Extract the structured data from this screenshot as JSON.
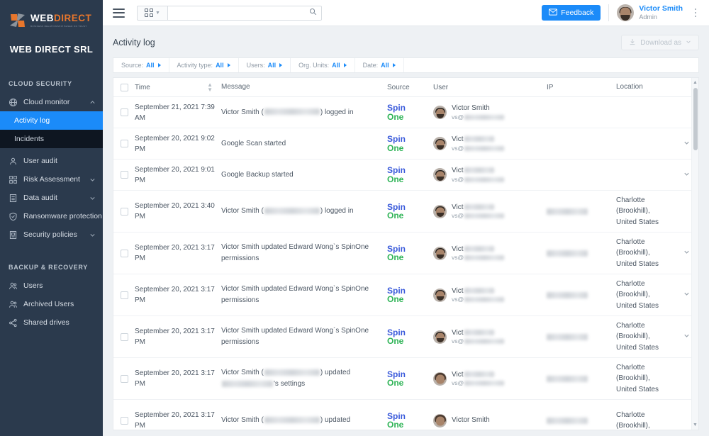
{
  "sidebar": {
    "logo": {
      "part1": "WEB",
      "part2": "DIRECT",
      "tagline": "BUSINESS RELATIONSHIP BASED ON TRUST"
    },
    "org_name": "WEB DIRECT SRL",
    "sections": [
      {
        "title": "CLOUD SECURITY",
        "items": [
          {
            "label": "Cloud monitor",
            "icon": "globe-icon",
            "caret": "up",
            "state": "expanded"
          },
          {
            "label": "Activity log",
            "icon": "",
            "state": "active-sub"
          },
          {
            "label": "Incidents",
            "icon": "",
            "state": "dark-sub"
          },
          {
            "label": "User audit",
            "icon": "person-icon",
            "caret": ""
          },
          {
            "label": "Risk Assessment",
            "icon": "grid-icon",
            "caret": "down"
          },
          {
            "label": "Data audit",
            "icon": "document-icon",
            "caret": "down"
          },
          {
            "label": "Ransomware protection",
            "icon": "shield-check-icon",
            "caret": ""
          },
          {
            "label": "Security policies",
            "icon": "policy-icon",
            "caret": "down"
          }
        ]
      },
      {
        "title": "BACKUP & RECOVERY",
        "items": [
          {
            "label": "Users",
            "icon": "users-icon",
            "caret": ""
          },
          {
            "label": "Archived Users",
            "icon": "users-archive-icon",
            "caret": ""
          },
          {
            "label": "Shared drives",
            "icon": "share-icon",
            "caret": ""
          }
        ]
      }
    ]
  },
  "topbar": {
    "menu_icon": "hamburger-icon",
    "app_switcher_icon": "grid-apps-icon",
    "search_placeholder": "",
    "search_value": "",
    "search_icon": "search-icon",
    "feedback_label": "Feedback",
    "feedback_icon": "envelope-icon",
    "user": {
      "name": "Victor Smith",
      "role": "Admin",
      "avatar": "user-avatar"
    },
    "overflow_icon": "kebab-menu-icon"
  },
  "page": {
    "title": "Activity log",
    "download_label": "Download as",
    "download_icon": "download-icon",
    "download_caret": "chevron-down-icon"
  },
  "filters": [
    {
      "label": "Source:",
      "value": "All"
    },
    {
      "label": "Activity type:",
      "value": "All"
    },
    {
      "label": "Users:",
      "value": "All"
    },
    {
      "label": "Org. Units:",
      "value": "All"
    },
    {
      "label": "Date:",
      "value": "All"
    }
  ],
  "table": {
    "columns": [
      "Time",
      "Message",
      "Source",
      "User",
      "IP",
      "Location"
    ],
    "source_logo": {
      "line1": "Spin",
      "line2": "One",
      "color1": "#3b5bdb",
      "color2": "#2fb457"
    },
    "rows": [
      {
        "time": "September 21, 2021 7:39 AM",
        "message_pre": "Victor Smith (",
        "message_post": ") logged in",
        "redacted_inline": true,
        "user_name": "Victor Smith",
        "user_mail_prefix": "vs@",
        "user_name_redacted": false,
        "ip_redacted": false,
        "location": "",
        "expandable": false,
        "avatar_variant": "male"
      },
      {
        "time": "September 20, 2021 9:02 PM",
        "message_pre": "Google Scan started",
        "message_post": "",
        "redacted_inline": false,
        "user_name": "Vict",
        "user_mail_prefix": "vs@",
        "user_name_redacted": true,
        "ip_redacted": false,
        "location": "",
        "expandable": true,
        "avatar_variant": "male"
      },
      {
        "time": "September 20, 2021 9:01 PM",
        "message_pre": "Google Backup started",
        "message_post": "",
        "redacted_inline": false,
        "user_name": "Vict",
        "user_mail_prefix": "vs@",
        "user_name_redacted": true,
        "ip_redacted": false,
        "location": "",
        "expandable": true,
        "avatar_variant": "male"
      },
      {
        "time": "September 20, 2021 3:40 PM",
        "message_pre": "Victor Smith (",
        "message_post": ") logged in",
        "redacted_inline": true,
        "user_name": "Vict",
        "user_mail_prefix": "vs@",
        "user_name_redacted": true,
        "ip_redacted": true,
        "location": "Charlotte (Brookhill), United States",
        "expandable": false,
        "avatar_variant": "male"
      },
      {
        "time": "September 20, 2021 3:17 PM",
        "message_pre": "Victor Smith updated Edward Wong`s SpinOne permissions",
        "message_post": "",
        "redacted_inline": false,
        "user_name": "Vict",
        "user_mail_prefix": "vs@",
        "user_name_redacted": true,
        "ip_redacted": true,
        "location": "Charlotte (Brookhill), United States",
        "expandable": true,
        "avatar_variant": "male"
      },
      {
        "time": "September 20, 2021 3:17 PM",
        "message_pre": "Victor Smith updated Edward Wong`s SpinOne permissions",
        "message_post": "",
        "redacted_inline": false,
        "user_name": "Vict",
        "user_mail_prefix": "vs@",
        "user_name_redacted": true,
        "ip_redacted": true,
        "location": "Charlotte (Brookhill), United States",
        "expandable": true,
        "avatar_variant": "male"
      },
      {
        "time": "September 20, 2021 3:17 PM",
        "message_pre": "Victor Smith updated Edward Wong`s SpinOne permissions",
        "message_post": "",
        "redacted_inline": false,
        "user_name": "Vict",
        "user_mail_prefix": "vs@",
        "user_name_redacted": true,
        "ip_redacted": true,
        "location": "Charlotte (Brookhill), United States",
        "expandable": true,
        "avatar_variant": "male"
      },
      {
        "time": "September 20, 2021 3:17 PM",
        "message_pre": "Victor Smith (",
        "message_post": ") updated",
        "message_line2_post": "'s settings",
        "redacted_inline": true,
        "two_line_redaction": true,
        "user_name": "Vict",
        "user_mail_prefix": "vs@",
        "user_name_redacted": true,
        "ip_redacted": true,
        "location": "Charlotte (Brookhill), United States",
        "expandable": false,
        "avatar_variant": "female"
      },
      {
        "time": "September 20, 2021 3:17 PM",
        "message_pre": "Victor Smith (",
        "message_post": ") updated",
        "redacted_inline": true,
        "user_name": "Victor Smith",
        "user_mail_prefix": "",
        "user_name_redacted": false,
        "ip_redacted": true,
        "location": "Charlotte (Brookhill),",
        "expandable": false,
        "avatar_variant": "female"
      }
    ]
  },
  "colors": {
    "accent": "#1b8bf9",
    "sidebar_bg": "#2b3a4d",
    "sidebar_sub_dark": "#0e1621",
    "brand_orange": "#e8762c"
  }
}
